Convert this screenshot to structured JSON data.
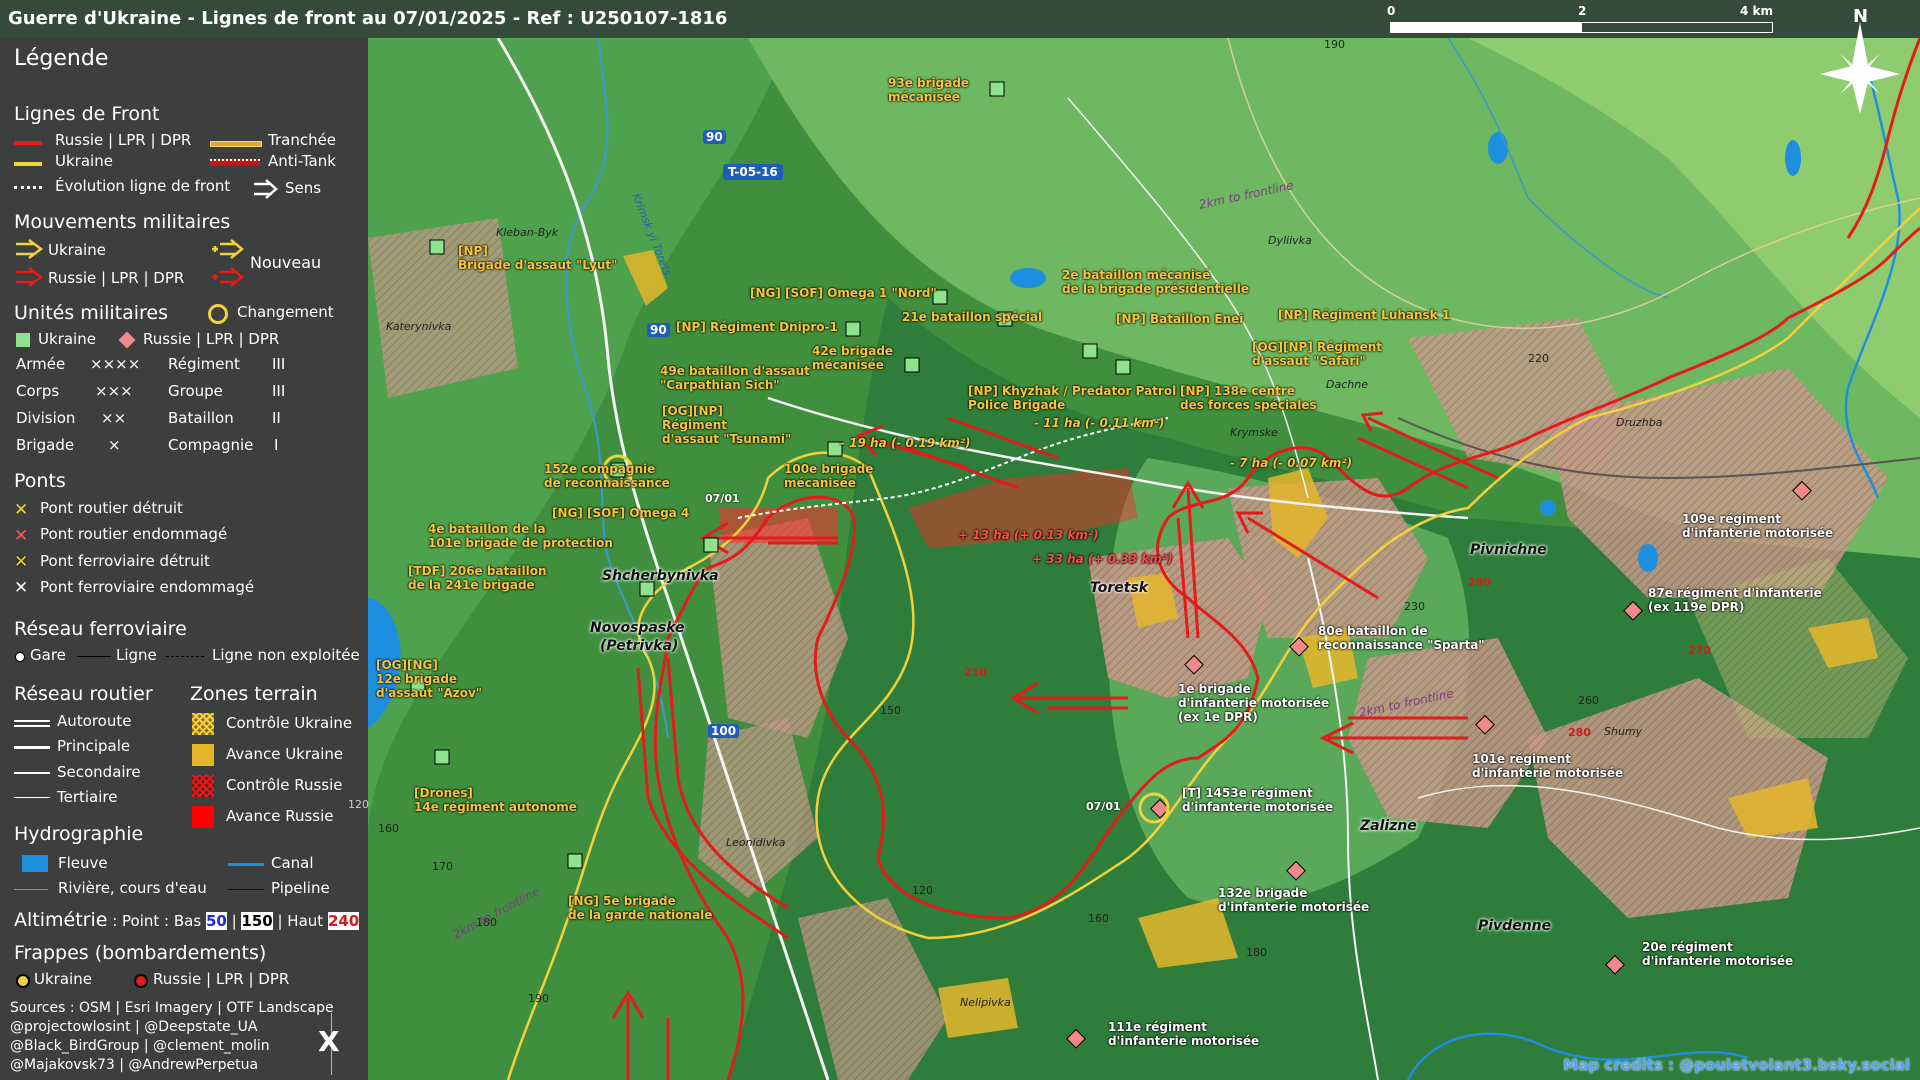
{
  "title": "Guerre d'Ukraine - Lignes de front au 07/01/2025 - Ref : U250107-1816",
  "scale": {
    "labels": [
      "0",
      "2",
      "4 km"
    ]
  },
  "north": "N",
  "colors": {
    "russia": "#e31b1b",
    "ukraine": "#f2d13b",
    "ukr_unit": "#8ee38e",
    "rus_unit": "#f08a8a"
  },
  "legend": {
    "heading": "Légende",
    "front": {
      "title": "Lignes de Front",
      "russia": "Russie | LPR | DPR",
      "ukraine": "Ukraine",
      "evolution": "Évolution ligne de front",
      "trench": "Tranchée",
      "antitank": "Anti-Tank",
      "direction": "Sens"
    },
    "moves": {
      "title": "Mouvements militaires",
      "ukraine": "Ukraine",
      "russia": "Russie | LPR | DPR",
      "new": "Nouveau"
    },
    "units": {
      "title": "Unités militaires",
      "change": "Changement",
      "ukraine": "Ukraine",
      "russia": "Russie | LPR | DPR",
      "rows": [
        {
          "a": "Armée",
          "as": "×××× ",
          "b": "Régiment",
          "bs": "III"
        },
        {
          "a": "Corps",
          "as": "×××",
          "b": "Groupe",
          "bs": "III"
        },
        {
          "a": "Division",
          "as": "××",
          "b": "Bataillon",
          "bs": "II"
        },
        {
          "a": "Brigade",
          "as": "×",
          "b": "Compagnie",
          "bs": "I"
        }
      ]
    },
    "bridges": {
      "title": "Ponts",
      "items": [
        "Pont routier détruit",
        "Pont routier endommagé",
        "Pont ferroviaire détruit",
        "Pont ferroviaire endommagé"
      ]
    },
    "rail": {
      "title": "Réseau ferroviaire",
      "station": "Gare",
      "line": "Ligne",
      "unused": "Ligne non exploitée"
    },
    "roads": {
      "title": "Réseau routier",
      "items": [
        "Autoroute",
        "Principale",
        "Secondaire",
        "Tertiaire"
      ]
    },
    "zones": {
      "title": "Zones terrain",
      "items": [
        "Contrôle Ukraine",
        "Avance Ukraine",
        "Contrôle Russie",
        "Avance Russie"
      ]
    },
    "hydro": {
      "title": "Hydrographie",
      "river": "Fleuve",
      "stream": "Rivière, cours d'eau",
      "canal": "Canal",
      "pipeline": "Pipeline"
    },
    "alt": {
      "title": "Altimétrie",
      "text": " : Point : Bas ",
      "low": "50",
      "sep": " | ",
      "mid": "150",
      "sep2": " | Haut ",
      "high": "240"
    },
    "strikes": {
      "title": "Frappes (bombardements)",
      "ukraine": "Ukraine",
      "russia": "Russie | LPR | DPR"
    },
    "sources": [
      "Sources : OSM | Esri Imagery | OTF Landscape",
      "@projectowlosint | @Deepstate_UA",
      "@Black_BirdGroup | @clement_molin",
      "@Majakovsk73 | @AndrewPerpetua"
    ],
    "x_icon": "X"
  },
  "map": {
    "credits": "Map credits : @pouletvolant3.bsky.social",
    "roads": [
      "T-05-16",
      "90",
      "90",
      "100"
    ],
    "towns": [
      "Toretsk",
      "Shcherbynivka",
      "Novospaske",
      "(Petrivka)",
      "Pivnichne",
      "Zalizne",
      "Pivdenne"
    ],
    "villages": [
      "Kleban-Byk",
      "Katerynivka",
      "Krimsk yi Torets",
      "Dyliivka",
      "Dachne",
      "Krymske",
      "Druzhba",
      "Leonidivka",
      "Nelipivka",
      "Shumy"
    ],
    "elevations": [
      "190",
      "220",
      "230",
      "260",
      "150",
      "120",
      "160",
      "170",
      "180",
      "180",
      "160",
      "190",
      "120"
    ],
    "elevations_red": [
      "290",
      "210",
      "270",
      "280"
    ],
    "front_text": [
      "2km to frontline",
      "2km to frontline",
      "2km to frontline"
    ],
    "areas": [
      "- 19 ha (- 0.19 km²)",
      "- 11 ha (- 0.11 km²)",
      "- 7 ha (- 0.07 km²)"
    ],
    "areas_red": [
      "+ 13 ha (+ 0.13 km²)",
      "+ 33 ha (+ 0.33 km²)"
    ],
    "dates": [
      "07/01",
      "07/01"
    ],
    "ukr_units": [
      "93e brigade\nmécanisée",
      "[NP]\nBrigade d'assaut \"Lyut\"",
      "[NG] [SOF] Omega 1 \"Nord\"",
      "2e bataillon mécanisé\nde la brigade présidentielle",
      "[NP] Régiment Dnipro-1",
      "21e bataillon spécial",
      "[NP] Bataillon Enei",
      "[NP] Régiment Luhansk 1",
      "42e brigade\nmécanisée",
      "[OG][NP] Régiment\nd'assaut \"Safari\"",
      "49e bataillon d'assaut\n\"Carpathian Sich\"",
      "[NP] Khyzhak / Predator Patrol\nPolice Brigade",
      "[NP] 138e centre\ndes forces spéciales",
      "[OG][NP]\nRégiment\nd'assaut \"Tsunami\"",
      "152e compagnie\nde reconnaissance",
      "100e brigade\nmécanisée",
      "[NG] [SOF] Omega 4",
      "4e bataillon de la\n101e brigade de protection",
      "[TDF] 206e bataillon\nde la 241e brigade",
      "[OG][NG]\n12e brigade\nd'assaut \"Azov\"",
      "[Drones]\n14e régiment autonome",
      "[NG] 5e brigade\nde la garde nationale"
    ],
    "rus_units": [
      "109e régiment\nd'infanterie motorisée",
      "87e régiment d'infanterie\n(ex 119e DPR)",
      "80e bataillon de\nreconnaissance \"Sparta\"",
      "1e brigade\nd'infanterie motorisée\n(ex 1e DPR)",
      "101e régiment\nd'infanterie motorisée",
      "[T] 1453e régiment\nd'infanterie motorisée",
      "132e brigade\nd'infanterie motorisée",
      "20e régiment\nd'infanterie motorisée",
      "111e régiment\nd'infanterie motorisée"
    ]
  }
}
